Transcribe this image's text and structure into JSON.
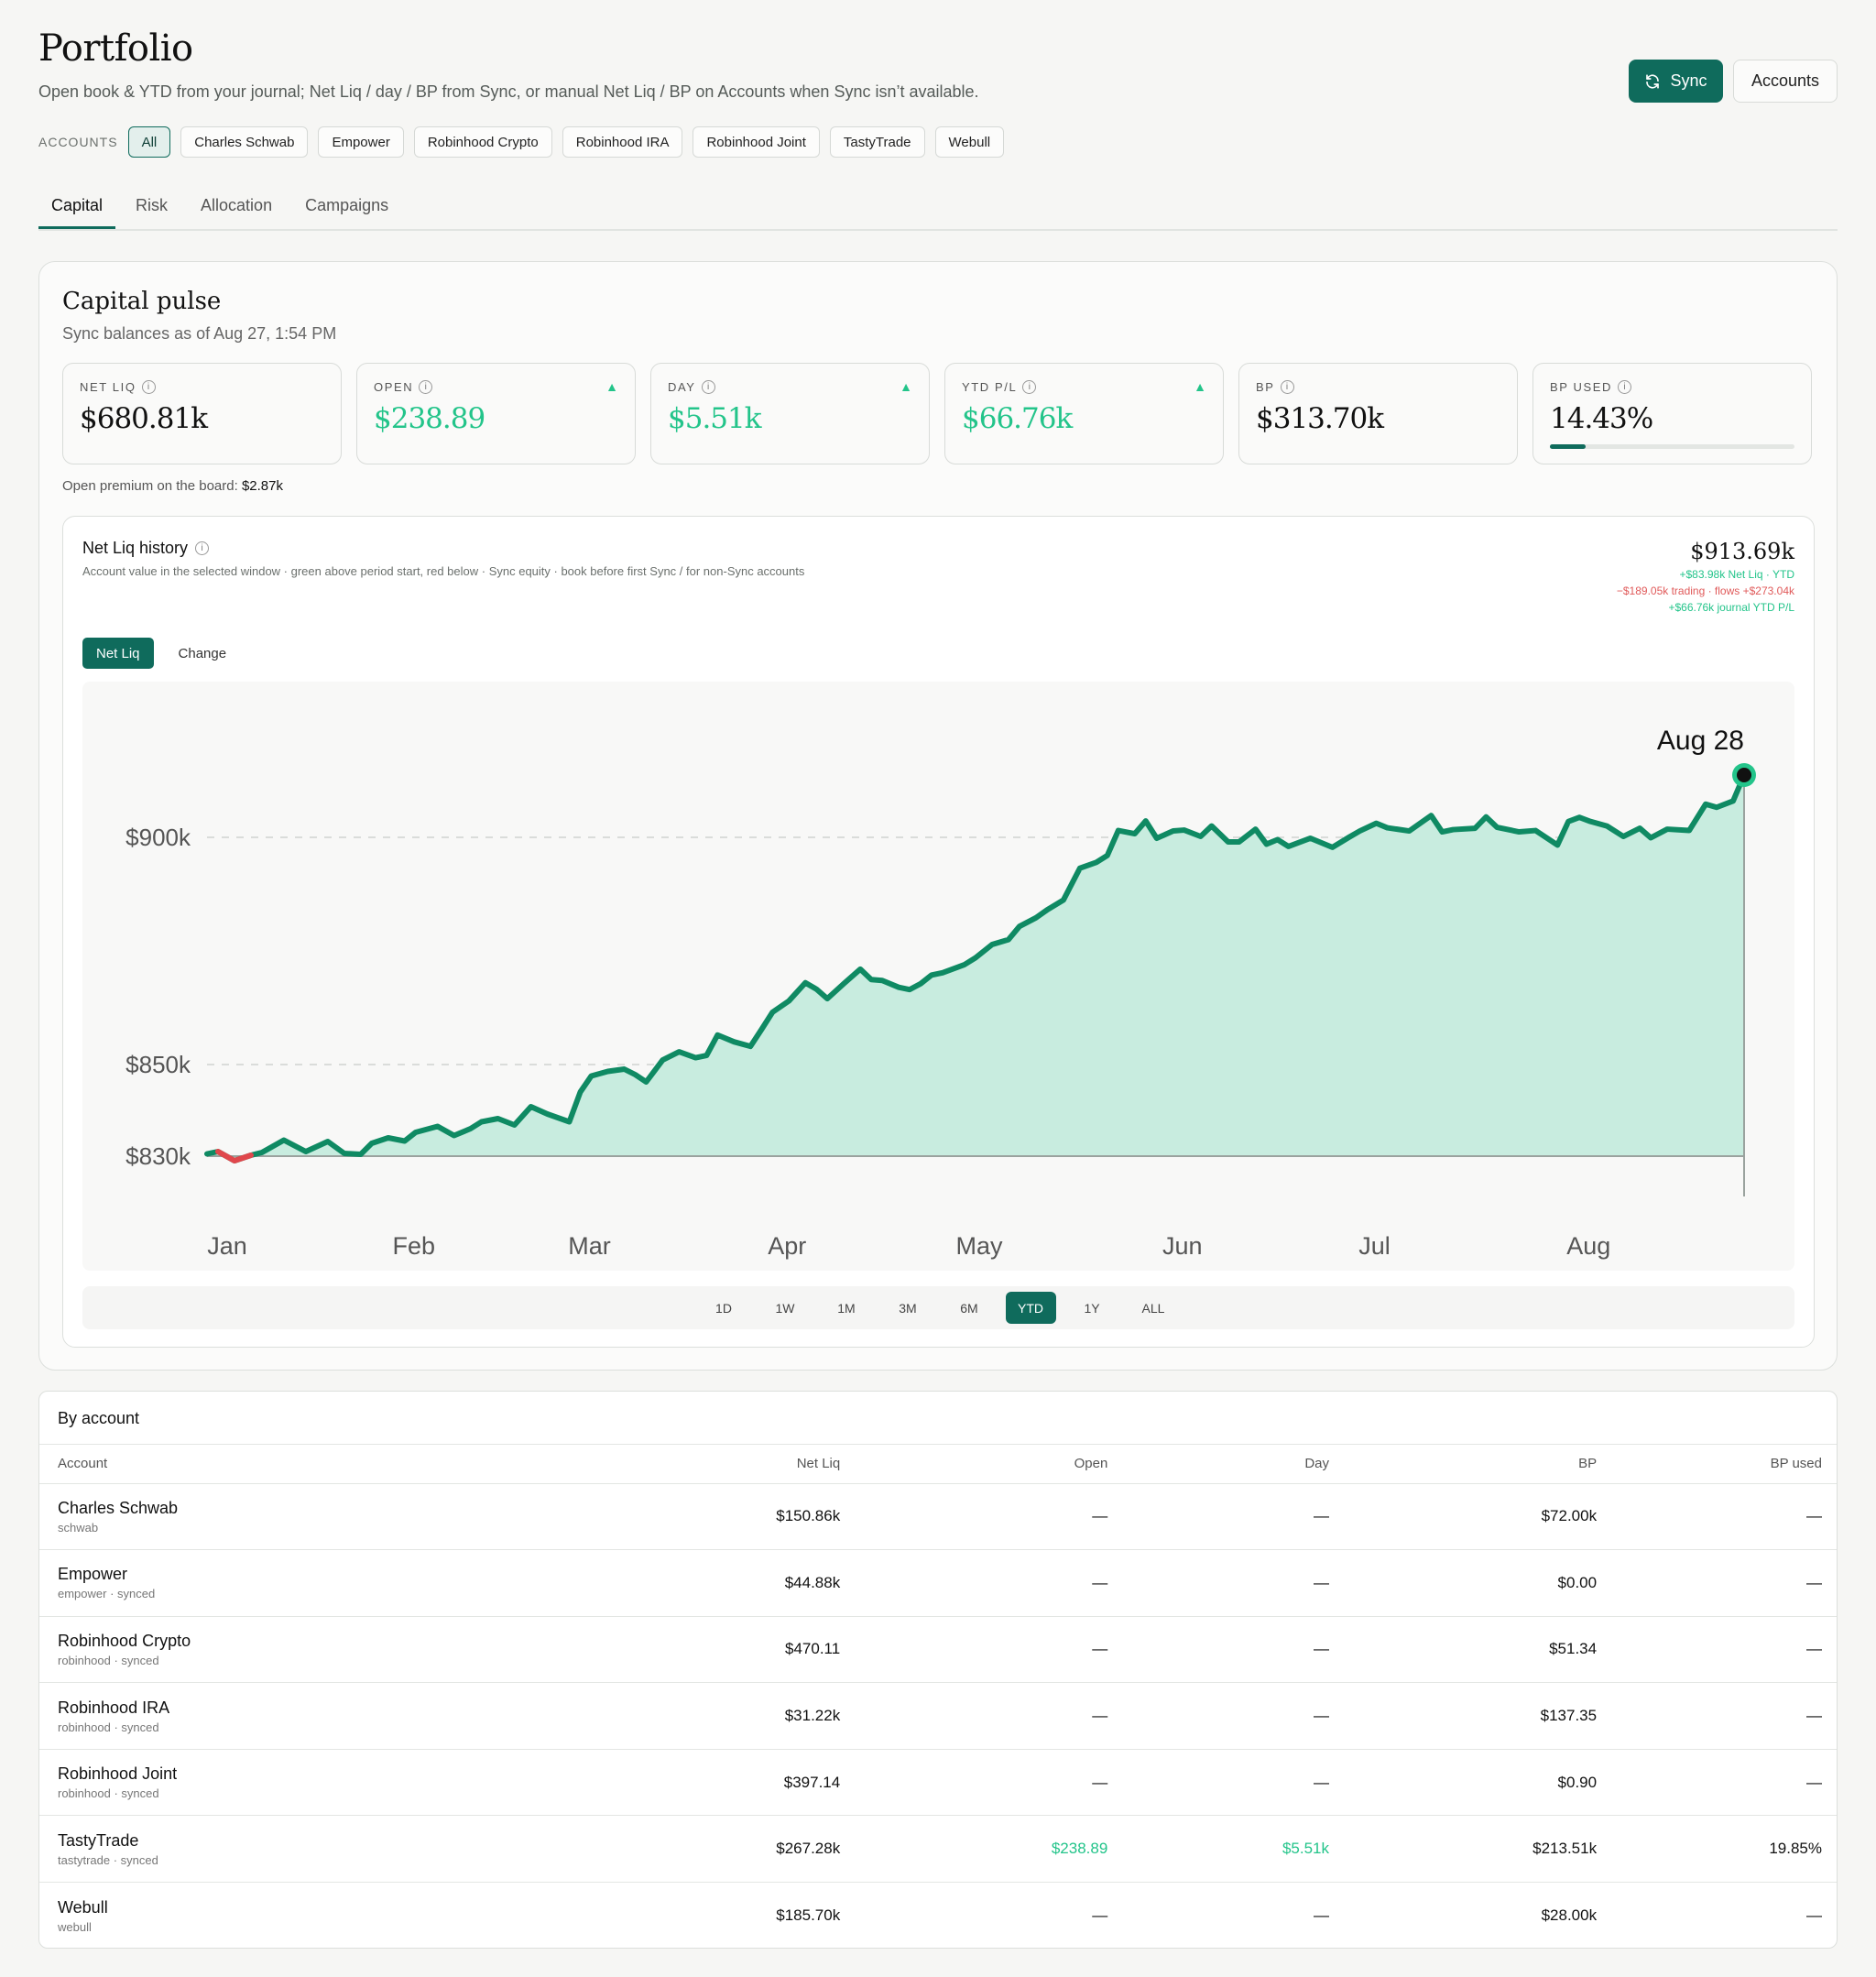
{
  "header": {
    "title": "Portfolio",
    "subtitle": "Open book & YTD from your journal; Net Liq / day / BP from Sync, or manual Net Liq / BP on Accounts when Sync isn’t available.",
    "sync_label": "Sync",
    "accounts_label": "Accounts"
  },
  "accounts_filter": {
    "label": "ACCOUNTS",
    "chips": [
      "All",
      "Charles Schwab",
      "Empower",
      "Robinhood Crypto",
      "Robinhood IRA",
      "Robinhood Joint",
      "TastyTrade",
      "Webull"
    ],
    "active": "All"
  },
  "tabs": {
    "items": [
      "Capital",
      "Risk",
      "Allocation",
      "Campaigns"
    ],
    "active": "Capital"
  },
  "pulse": {
    "title": "Capital pulse",
    "subtitle": "Sync balances as of Aug 27, 1:54 PM",
    "metrics": [
      {
        "label": "NET LIQ",
        "value": "$680.81k",
        "positive": false,
        "trend": false
      },
      {
        "label": "OPEN",
        "value": "$238.89",
        "positive": true,
        "trend": true
      },
      {
        "label": "DAY",
        "value": "$5.51k",
        "positive": true,
        "trend": true
      },
      {
        "label": "YTD P/L",
        "value": "$66.76k",
        "positive": true,
        "trend": true
      },
      {
        "label": "BP",
        "value": "$313.70k",
        "positive": false,
        "trend": false
      },
      {
        "label": "BP USED",
        "value": "14.43%",
        "positive": false,
        "trend": false,
        "bar_fraction": 0.1443
      }
    ],
    "open_premium_label": "Open premium on the board:",
    "open_premium_value": "$2.87k"
  },
  "net_liq_chart": {
    "title": "Net Liq history",
    "description": "Account value in the selected window · green above period start, red below · Sync equity · book before first Sync / for non-Sync accounts",
    "summary_value": "$913.69k",
    "summary_lines": [
      {
        "text": "+$83.98k Net Liq · YTD",
        "tone": "pos"
      },
      {
        "text": "−$189.05k trading · flows +$273.04k",
        "tone": "neg"
      },
      {
        "text": "+$66.76k journal YTD P/L",
        "tone": "pos"
      }
    ],
    "modes": [
      "Net Liq",
      "Change"
    ],
    "active_mode": "Net Liq",
    "ranges": [
      "1D",
      "1W",
      "1M",
      "3M",
      "6M",
      "YTD",
      "1Y",
      "ALL"
    ],
    "active_range": "YTD",
    "colors": {
      "line": "#0f8a63",
      "fill": "#c8ecdf",
      "negative": "#e0474c"
    }
  },
  "chart_data": {
    "type": "area",
    "ylabel": "",
    "xlabel": "",
    "y_ticks": [
      830000,
      850000,
      900000
    ],
    "y_tick_labels": [
      "$830k",
      "$850k",
      "$900k"
    ],
    "baseline": 830000,
    "x_ticks": [
      0,
      34,
      66,
      102,
      137,
      174,
      209,
      248
    ],
    "x_tick_labels": [
      "Jan",
      "Feb",
      "Mar",
      "Apr",
      "May",
      "Jun",
      "Jul",
      "Aug"
    ],
    "highlight_label": "Aug 28",
    "highlight_index": 280,
    "series": [
      {
        "x": [
          0,
          2,
          5,
          8,
          10,
          14,
          18,
          22,
          25,
          28,
          30,
          33,
          36,
          38,
          42,
          45,
          48,
          50,
          53,
          56,
          59,
          62,
          66,
          68,
          70,
          73,
          76,
          78,
          80,
          83,
          86,
          89,
          91,
          93,
          96,
          99,
          101,
          103,
          106,
          109,
          111,
          113,
          116,
          119,
          121,
          123,
          126,
          128,
          130,
          132,
          134,
          138,
          140,
          143,
          146,
          148,
          151,
          153,
          156,
          159,
          162,
          164,
          166,
          169,
          171,
          173,
          176,
          178,
          181,
          183,
          186,
          188,
          191,
          193,
          195,
          197,
          201,
          205,
          208,
          210,
          213,
          215,
          219,
          223,
          225,
          227,
          231,
          233,
          235,
          239,
          242,
          246,
          248,
          250,
          252,
          255,
          258,
          261,
          263,
          266,
          270,
          273,
          275,
          278,
          280
        ],
        "y": [
          830500,
          831000,
          829000,
          830200,
          830800,
          833500,
          831000,
          833200,
          830600,
          830400,
          832800,
          834000,
          833300,
          835200,
          836500,
          834500,
          836000,
          837500,
          838200,
          836800,
          840800,
          839200,
          837500,
          844000,
          847500,
          848500,
          849000,
          847800,
          846200,
          851000,
          852800,
          851500,
          852000,
          856500,
          855000,
          854000,
          857700,
          861500,
          864000,
          868000,
          866600,
          864500,
          867800,
          871000,
          868700,
          868500,
          867000,
          866500,
          867800,
          869700,
          870200,
          872000,
          873500,
          876400,
          877500,
          880400,
          882300,
          884000,
          886200,
          893200,
          894500,
          896000,
          901500,
          900800,
          903600,
          899800,
          901400,
          901600,
          900200,
          902500,
          899000,
          899000,
          901800,
          898500,
          899500,
          898000,
          899800,
          897800,
          900000,
          901400,
          903100,
          902100,
          901400,
          904800,
          901200,
          901700,
          902000,
          904500,
          902200,
          901200,
          901500,
          898300,
          903500,
          904400,
          903500,
          902500,
          900200,
          902000,
          899900,
          901800,
          901500,
          907300,
          906600,
          908000,
          913700
        ]
      }
    ]
  },
  "by_account": {
    "title": "By account",
    "columns": [
      "Account",
      "Net Liq",
      "Open",
      "Day",
      "BP",
      "BP used"
    ],
    "rows": [
      {
        "name": "Charles Schwab",
        "sub": "schwab",
        "net_liq": "$150.86k",
        "open": "—",
        "day": "—",
        "bp": "$72.00k",
        "bp_used": "—"
      },
      {
        "name": "Empower",
        "sub": "empower · synced",
        "net_liq": "$44.88k",
        "open": "—",
        "day": "—",
        "bp": "$0.00",
        "bp_used": "—"
      },
      {
        "name": "Robinhood Crypto",
        "sub": "robinhood · synced",
        "net_liq": "$470.11",
        "open": "—",
        "day": "—",
        "bp": "$51.34",
        "bp_used": "—"
      },
      {
        "name": "Robinhood IRA",
        "sub": "robinhood · synced",
        "net_liq": "$31.22k",
        "open": "—",
        "day": "—",
        "bp": "$137.35",
        "bp_used": "—"
      },
      {
        "name": "Robinhood Joint",
        "sub": "robinhood · synced",
        "net_liq": "$397.14",
        "open": "—",
        "day": "—",
        "bp": "$0.90",
        "bp_used": "—"
      },
      {
        "name": "TastyTrade",
        "sub": "tastytrade · synced",
        "net_liq": "$267.28k",
        "open": "$238.89",
        "day": "$5.51k",
        "bp": "$213.51k",
        "bp_used": "19.85%",
        "positive": true
      },
      {
        "name": "Webull",
        "sub": "webull",
        "net_liq": "$185.70k",
        "open": "—",
        "day": "—",
        "bp": "$28.00k",
        "bp_used": "—"
      }
    ]
  }
}
